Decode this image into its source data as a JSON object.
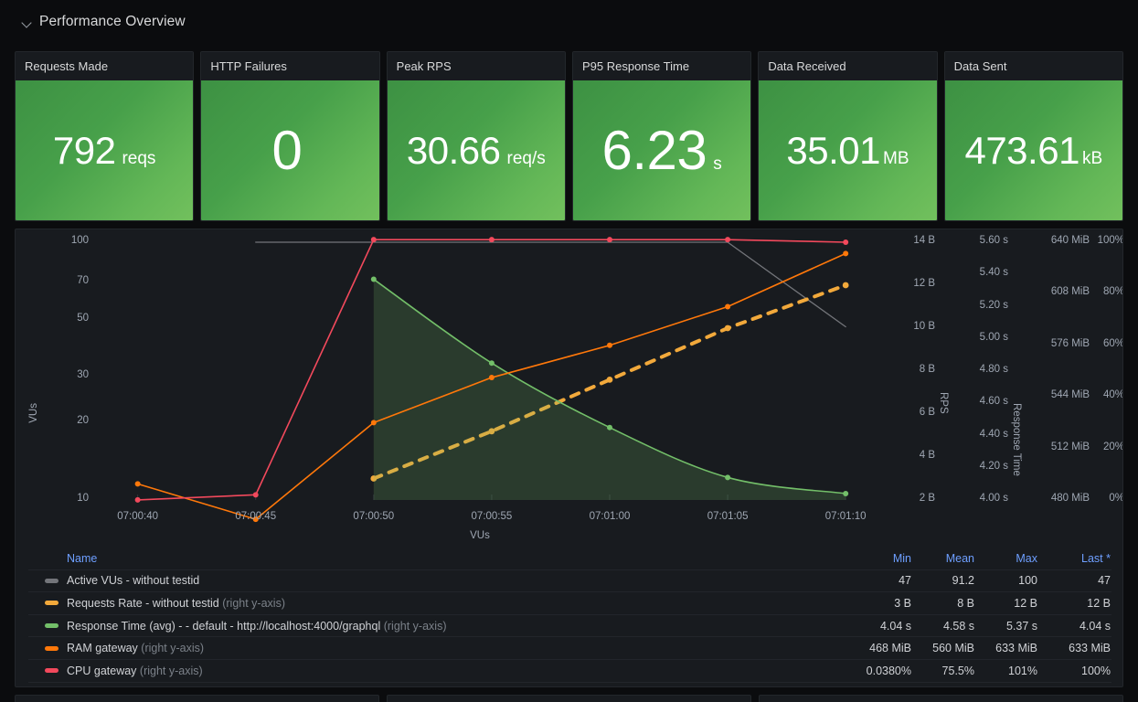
{
  "row": {
    "title": "Performance Overview",
    "chevron_icon": "chevron-down-icon",
    "collapsed": false
  },
  "stats": [
    {
      "title": "Requests Made",
      "value": "792",
      "unit": "reqs",
      "color": "#47a04a",
      "size": "normal"
    },
    {
      "title": "HTTP Failures",
      "value": "0",
      "unit": "",
      "color": "#47a04a",
      "size": "big"
    },
    {
      "title": "Peak RPS",
      "value": "30.66",
      "unit": "req/s",
      "color": "#47a04a",
      "size": "normal"
    },
    {
      "title": "P95 Response Time",
      "value": "6.23",
      "unit": "s",
      "color": "#47a04a",
      "size": "normal"
    },
    {
      "title": "Data Received",
      "value": "35.01",
      "unit": "MB",
      "color": "#47a04a",
      "size": "normal"
    },
    {
      "title": "Data Sent",
      "value": "473.61",
      "unit": "kB",
      "color": "#47a04a",
      "size": "normal"
    }
  ],
  "chart_data": {
    "type": "line",
    "title": "",
    "xlabel": "VUs",
    "x_ticks": [
      "07:00:40",
      "07:00:45",
      "07:00:50",
      "07:00:55",
      "07:01:00",
      "07:01:05",
      "07:01:10"
    ],
    "x_range": [
      "07:00:38",
      "07:01:11"
    ],
    "grid": false,
    "legend_position": "bottom-table",
    "axes": [
      {
        "id": "left-vus",
        "name": "VUs",
        "side": "left",
        "scale": "log",
        "ticks": [
          "100",
          "70",
          "50",
          "30",
          "20",
          "10"
        ],
        "tick_values": [
          100,
          70,
          50,
          30,
          20,
          10
        ]
      },
      {
        "id": "right-rps",
        "name": "RPS",
        "side": "right",
        "scale": "linear",
        "ticks": [
          "14 B",
          "12 B",
          "10 B",
          "8 B",
          "6 B",
          "4 B",
          "2 B"
        ],
        "tick_values": [
          14,
          12,
          10,
          8,
          6,
          4,
          2
        ]
      },
      {
        "id": "right-rt",
        "name": "Response Time",
        "side": "right",
        "scale": "linear",
        "ticks": [
          "5.60 s",
          "5.40 s",
          "5.20 s",
          "5.00 s",
          "4.80 s",
          "4.60 s",
          "4.40 s",
          "4.20 s",
          "4.00 s"
        ],
        "tick_values": [
          5.6,
          5.4,
          5.2,
          5.0,
          4.8,
          4.6,
          4.4,
          4.2,
          4.0
        ]
      },
      {
        "id": "right-mem",
        "name": "",
        "side": "right",
        "scale": "linear",
        "ticks": [
          "640 MiB",
          "608 MiB",
          "576 MiB",
          "544 MiB",
          "512 MiB",
          "480 MiB"
        ],
        "tick_values": [
          640,
          608,
          576,
          544,
          512,
          480
        ]
      },
      {
        "id": "right-pct",
        "name": "",
        "side": "right",
        "scale": "linear",
        "ticks": [
          "100%",
          "80%",
          "60%",
          "40%",
          "20%",
          "0%"
        ],
        "tick_values": [
          100,
          80,
          60,
          40,
          20,
          0
        ]
      }
    ],
    "series": [
      {
        "name": "Active VUs - without testid",
        "color": "#73757a",
        "axis": "left-vus",
        "style": "solid",
        "fill": false,
        "points": false,
        "x": [
          "07:00:45",
          "07:01:05",
          "07:01:10"
        ],
        "values": [
          100,
          100,
          47
        ]
      },
      {
        "name": "Requests Rate - without testid",
        "color": "#f2a93b",
        "axis": "right-rps",
        "style": "dashed",
        "fill": false,
        "points": true,
        "x": [
          "07:00:50",
          "07:00:55",
          "07:01:00",
          "07:01:05",
          "07:01:10"
        ],
        "values": [
          3,
          5.2,
          7.6,
          10,
          12
        ]
      },
      {
        "name": "Response Time (avg) - - default - http://localhost:4000/graphql",
        "color": "#73bf69",
        "axis": "right-rt",
        "style": "solid",
        "fill": true,
        "points": true,
        "x": [
          "07:00:50",
          "07:00:55",
          "07:01:00",
          "07:01:05",
          "07:01:10"
        ],
        "values": [
          5.37,
          4.85,
          4.45,
          4.14,
          4.04
        ]
      },
      {
        "name": "RAM gateway",
        "color": "#ff780a",
        "axis": "right-mem",
        "style": "solid",
        "fill": false,
        "points": true,
        "x": [
          "07:00:40",
          "07:00:45",
          "07:00:50",
          "07:00:55",
          "07:01:00",
          "07:01:05",
          "07:01:10"
        ],
        "values": [
          490,
          468,
          528,
          556,
          576,
          600,
          633
        ]
      },
      {
        "name": "CPU gateway",
        "color": "#f2495c",
        "axis": "right-pct",
        "style": "solid",
        "fill": false,
        "points": true,
        "x": [
          "07:00:40",
          "07:00:45",
          "07:00:50",
          "07:00:55",
          "07:01:00",
          "07:01:05",
          "07:01:10"
        ],
        "values": [
          0.038,
          2,
          101,
          101,
          101,
          101,
          100
        ]
      }
    ]
  },
  "legend": {
    "columns": [
      "Name",
      "Min",
      "Mean",
      "Max",
      "Last *"
    ],
    "rows": [
      {
        "swatch": "#73757a",
        "name": "Active VUs - without testid",
        "suffix": "",
        "min": "47",
        "mean": "91.2",
        "max": "100",
        "last": "47"
      },
      {
        "swatch": "#f2a93b",
        "name": "Requests Rate - without testid",
        "suffix": "(right y-axis)",
        "min": "3 B",
        "mean": "8 B",
        "max": "12 B",
        "last": "12 B"
      },
      {
        "swatch": "#73bf69",
        "name": "Response Time (avg) - - default - http://localhost:4000/graphql",
        "suffix": "(right y-axis)",
        "min": "4.04 s",
        "mean": "4.58 s",
        "max": "5.37 s",
        "last": "4.04 s"
      },
      {
        "swatch": "#ff780a",
        "name": "RAM gateway",
        "suffix": "(right y-axis)",
        "min": "468 MiB",
        "mean": "560 MiB",
        "max": "633 MiB",
        "last": "633 MiB"
      },
      {
        "swatch": "#f2495c",
        "name": "CPU gateway",
        "suffix": "(right y-axis)",
        "min": "0.0380%",
        "mean": "75.5%",
        "max": "101%",
        "last": "100%"
      }
    ]
  }
}
